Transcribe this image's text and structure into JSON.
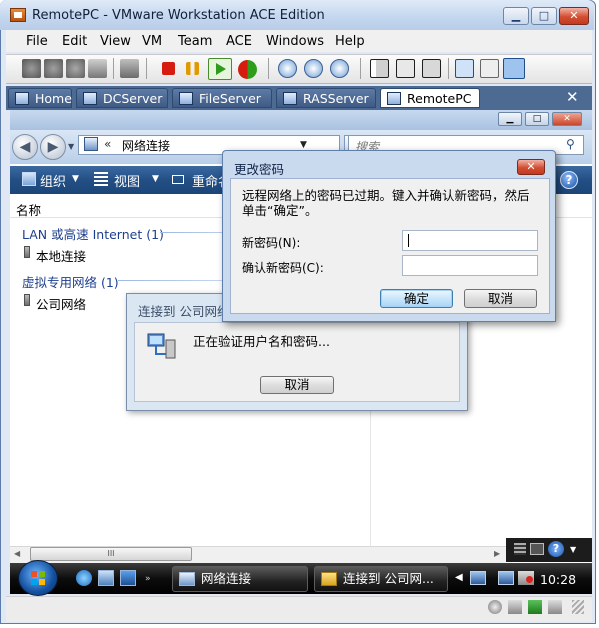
{
  "vm": {
    "title": "RemotePC - VMware Workstation ACE Edition",
    "window_buttons": {
      "minimize": "▁",
      "maximize": "□",
      "close": "✕"
    },
    "menu": [
      "File",
      "Edit",
      "View",
      "VM",
      "Team",
      "ACE",
      "Windows",
      "Help"
    ],
    "tabs": [
      {
        "label": "Home"
      },
      {
        "label": "DCServer"
      },
      {
        "label": "FileServer"
      },
      {
        "label": "RASServer"
      },
      {
        "label": "RemotePC"
      }
    ],
    "tab_close": "✕"
  },
  "explorer": {
    "address_chevron": "«",
    "address": "网络连接",
    "address_dropdown": "▼",
    "refresh": "⇆",
    "search_placeholder": "搜索",
    "command_bar": {
      "organize": "组织",
      "views": "视图",
      "rename": "重命名",
      "dropdown": "▼",
      "help": "?"
    },
    "column_name": "名称",
    "groups": [
      {
        "title": "LAN 或高速 Internet (1)",
        "items": [
          "本地连接"
        ]
      },
      {
        "title": "虚拟专用网络 (1)",
        "items": [
          "公司网络"
        ]
      }
    ],
    "scroll_thumb": "III"
  },
  "taskbar": {
    "buttons": [
      {
        "label": "网络连接"
      },
      {
        "label": "连接到 公司网..."
      }
    ],
    "time": "10:28",
    "chevron": "◀"
  },
  "connect_dialog": {
    "title": "连接到 公司网络",
    "message": "正在验证用户名和密码...",
    "cancel": "取消"
  },
  "password_dialog": {
    "title": "更改密码",
    "close": "✕",
    "message": "远程网络上的密码已过期。键入并确认新密码，然后单击“确定”。",
    "new_password_label": "新密码(N):",
    "confirm_password_label": "确认新密码(C):",
    "new_password_value": "",
    "confirm_password_value": "",
    "ok": "确定",
    "cancel": "取消"
  },
  "colors": {
    "command_bar": "#234f85",
    "group_title": "#1e3f8e",
    "tab_bar": "#4d6a93"
  }
}
